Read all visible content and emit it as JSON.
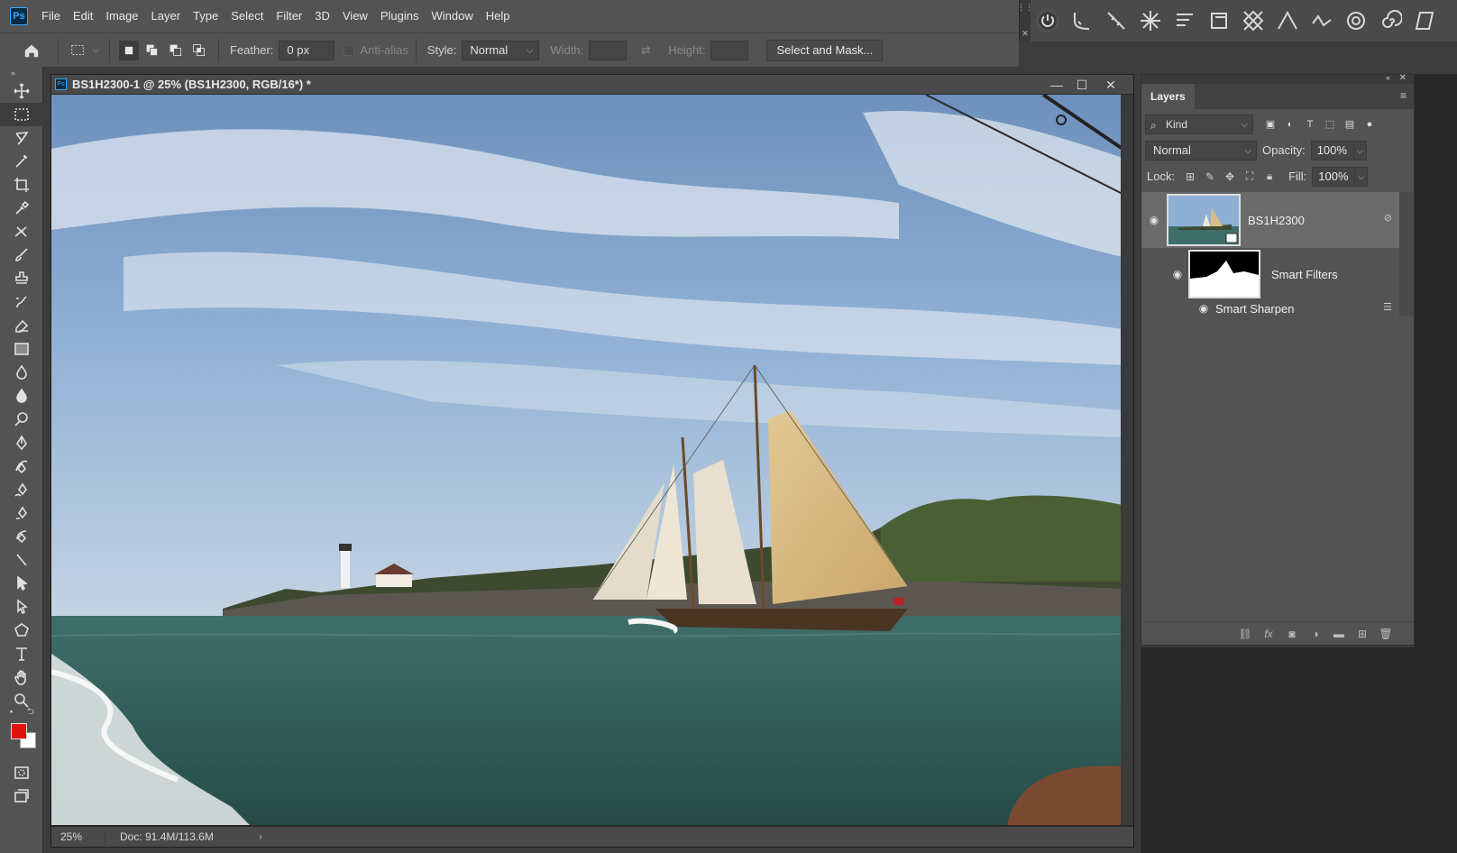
{
  "menubar": {
    "items": [
      "File",
      "Edit",
      "Image",
      "Layer",
      "Type",
      "Select",
      "Filter",
      "3D",
      "View",
      "Plugins",
      "Window",
      "Help"
    ],
    "logo": "Ps"
  },
  "options": {
    "feather_label": "Feather:",
    "feather_value": "0 px",
    "antialias_label": "Anti-alias",
    "style_label": "Style:",
    "style_value": "Normal",
    "width_label": "Width:",
    "height_label": "Height:",
    "select_mask": "Select and Mask..."
  },
  "document": {
    "title": "BS1H2300-1 @ 25% (BS1H2300, RGB/16*) *",
    "zoom": "25%",
    "doc_info": "Doc: 91.4M/113.6M"
  },
  "layers_panel": {
    "tab": "Layers",
    "kind": "Kind",
    "blend_mode": "Normal",
    "opacity_label": "Opacity:",
    "opacity_value": "100%",
    "lock_label": "Lock:",
    "fill_label": "Fill:",
    "fill_value": "100%",
    "layers": [
      {
        "name": "BS1H2300"
      },
      {
        "name": "Smart Filters"
      },
      {
        "name": "Smart Sharpen"
      }
    ]
  },
  "colors": {
    "foreground": "#e0110f",
    "background": "#ffffff"
  }
}
